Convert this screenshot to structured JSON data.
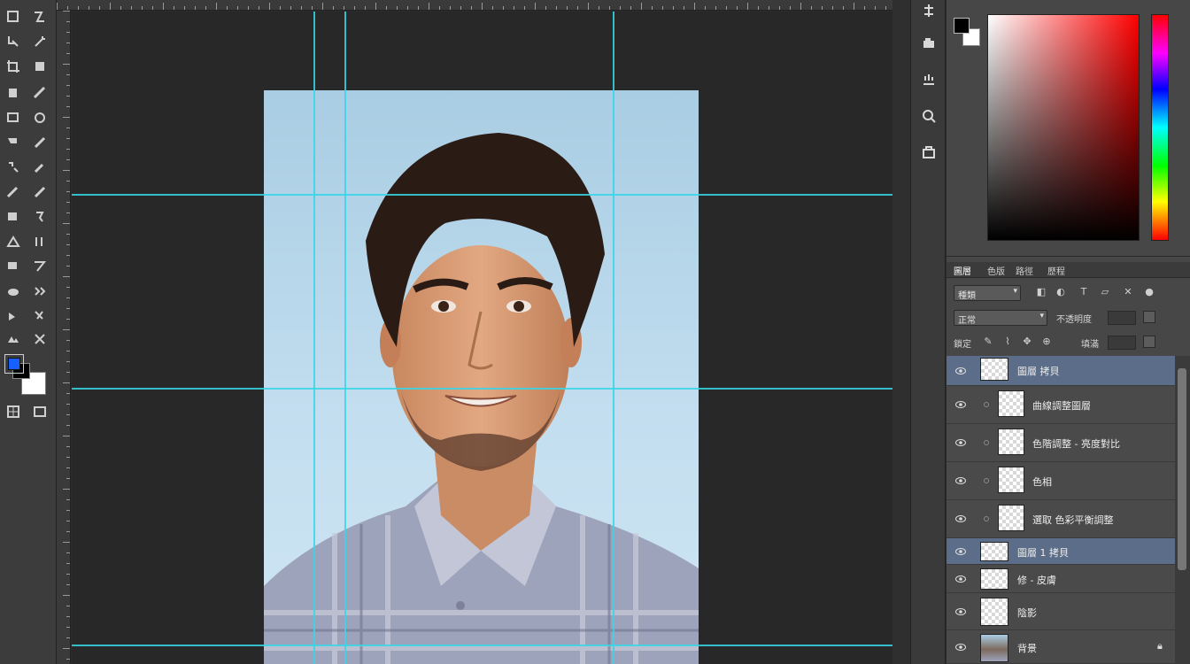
{
  "ruler_top": {
    "labels": [
      "",
      "",
      "",
      "",
      "",
      "",
      "",
      "",
      "",
      "",
      "",
      "",
      "",
      "",
      ""
    ]
  },
  "layers_panel": {
    "tabs": [
      "圖層",
      "色版",
      "路徑",
      "歷程"
    ],
    "filter_dropdown": "種類",
    "blend_mode": "正常",
    "opacity_label": "不透明度",
    "opacity_value": "",
    "lock_label": "鎖定",
    "fill_label": "填滿",
    "fill_value": "",
    "layers": [
      {
        "name": "圖層 拷貝",
        "selected": true,
        "indent": false
      },
      {
        "name": "曲線調整圖層",
        "selected": false,
        "indent": true
      },
      {
        "name": "色階調整 - 亮度對比",
        "selected": false,
        "indent": true
      },
      {
        "name": "色相",
        "selected": false,
        "indent": true
      },
      {
        "name": "選取 色彩平衡調整",
        "selected": false,
        "indent": true
      },
      {
        "name": "圖層 1 拷貝",
        "selected": true,
        "indent": false
      },
      {
        "name": "修 - 皮膚",
        "selected": false,
        "indent": false
      },
      {
        "name": "陰影",
        "selected": false,
        "indent": false
      },
      {
        "name": "背景",
        "selected": false,
        "indent": false
      }
    ]
  },
  "colors": {
    "guide": "#35d7e8",
    "foreground": "#1560ff",
    "selection": "#5b6d88"
  }
}
